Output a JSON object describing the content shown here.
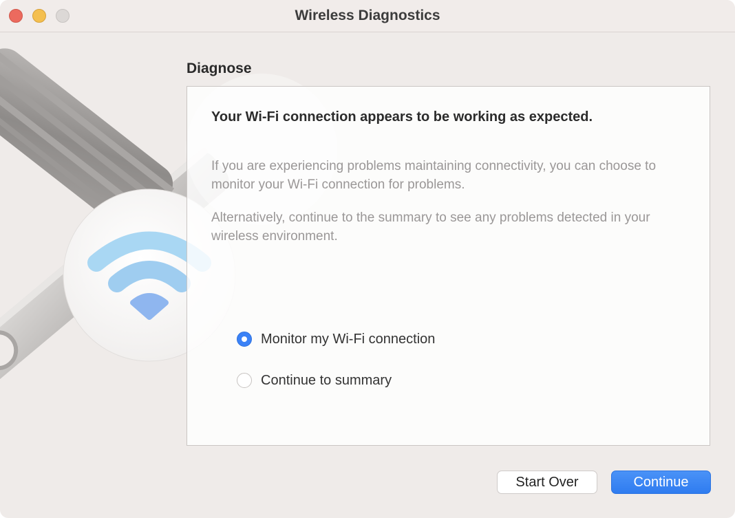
{
  "window": {
    "title": "Wireless Diagnostics"
  },
  "colors": {
    "accent": "#3b82f6",
    "wifi_icon": "#9fd0f0"
  },
  "icons": {
    "illustration": "wrench-wifi-icon",
    "traffic_lights": [
      "close-icon",
      "minimize-icon",
      "zoom-icon"
    ]
  },
  "main": {
    "section_title": "Diagnose",
    "headline": "Your Wi-Fi connection appears to be working as expected.",
    "paragraph_1": "If you are experiencing problems maintaining connectivity, you can choose to monitor your Wi-Fi connection for problems.",
    "paragraph_2": "Alternatively, continue to the summary to see any problems detected in your wireless environment.",
    "options": [
      {
        "label": "Monitor my Wi-Fi connection",
        "selected": true
      },
      {
        "label": "Continue to summary",
        "selected": false
      }
    ]
  },
  "footer": {
    "start_over_label": "Start Over",
    "continue_label": "Continue"
  }
}
